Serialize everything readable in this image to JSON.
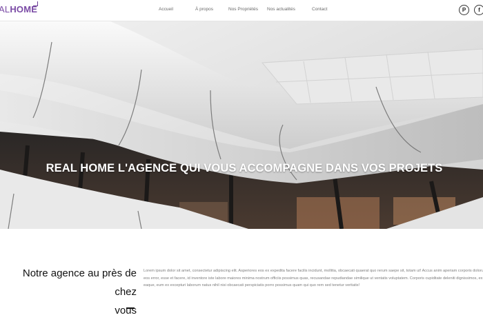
{
  "header": {
    "logo_prefix": "AL",
    "logo_main": "HOME",
    "nav": [
      "Accueil",
      "À propos",
      "Nos Propriétés",
      "Nos actualités",
      "Contact"
    ],
    "social": [
      {
        "icon": "pinterest-icon",
        "glyph": "P"
      },
      {
        "icon": "facebook-icon",
        "glyph": "f"
      }
    ]
  },
  "hero": {
    "title": "REAL HOME L'AGENCE QUI VOUS ACCOMPAGNE DANS VOS PROJETS"
  },
  "about": {
    "title_line1": "Notre agence au près de chez",
    "title_line2": "vous",
    "body": "Lorem ipsum dolor sit amet, consectetur adipiscing elit. Asperiores eos ex expedita facere facilis incidunt, mollitia, obcaecati quaerat quo rerum saepe sit, totam ut! Accus anim aperiam corporis dolorum eos error, esse et facere, id inventore iste labore maiores minima nostrum officiis possimus quas, recusandae repudiandae similique ut ventatis voluptatem. Corporis cupiditate deleniti dignissimos, ex eaque, eum ex excepturi laborum natus nihil nisi obcaecati perspiciatis porro possimus quam qui quo rem sed tenetur veritatis!"
  },
  "colors": {
    "brand": "#7a4aa5"
  }
}
